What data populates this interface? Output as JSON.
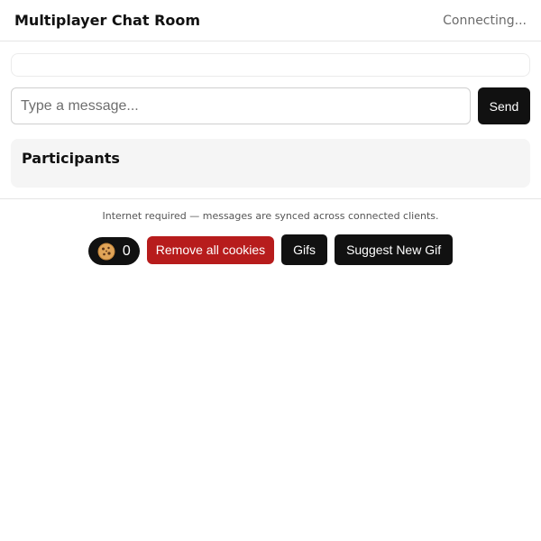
{
  "header": {
    "title": "Multiplayer Chat Room",
    "status": "Connecting..."
  },
  "composer": {
    "placeholder": "Type a message...",
    "value": "",
    "send_label": "Send"
  },
  "participants": {
    "heading": "Participants"
  },
  "footer": {
    "note": "Internet required — messages are synced across connected clients.",
    "cookie_icon": "cookie-icon",
    "cookie_count": "0",
    "remove_cookies_label": "Remove all cookies",
    "gifs_label": "Gifs",
    "suggest_gif_label": "Suggest New Gif"
  },
  "colors": {
    "danger": "#b71c1c",
    "dark": "#111111",
    "panel": "#f5f5f5"
  }
}
